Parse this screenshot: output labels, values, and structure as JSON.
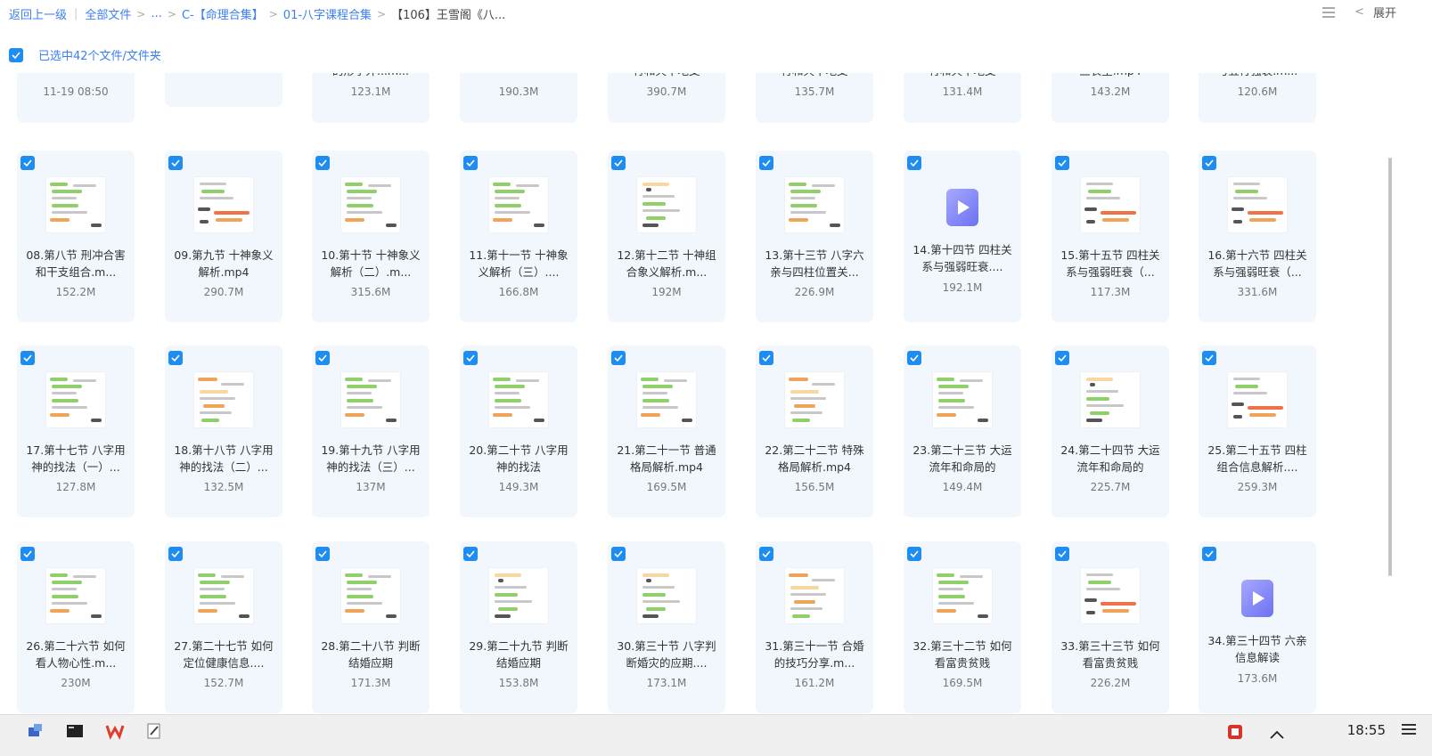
{
  "breadcrumb": {
    "back": "返回上一级",
    "all_files": "全部文件",
    "ellipsis": "...",
    "c_folder": "C-【命理合集】",
    "course": "01-八字课程合集",
    "current": "【106】王雪阁《八..."
  },
  "toolbar": {
    "expand": "展开"
  },
  "selection": {
    "label": "已选中42个文件/文件夹"
  },
  "top_partial": [
    {
      "name": "",
      "size": "11-19 08:50"
    },
    {
      "name": "",
      "size": ""
    },
    {
      "name": "的形学外...m...",
      "size": "123.1M"
    },
    {
      "name": "",
      "size": "190.3M"
    },
    {
      "name": "行和天干地支",
      "size": "390.7M"
    },
    {
      "name": "行和天干地支",
      "size": "135.7M"
    },
    {
      "name": "行和天干地支",
      "size": "131.4M"
    },
    {
      "name": "三长生.mp4",
      "size": "143.2M"
    },
    {
      "name": "与五行强衰.m...",
      "size": "120.6M"
    }
  ],
  "rows": [
    [
      {
        "name": "08.第八节 刑冲合害和干支组合.m...",
        "size": "152.2M",
        "thumb": "a"
      },
      {
        "name": "09.第九节 十神象义解析.mp4",
        "size": "290.7M",
        "thumb": "c"
      },
      {
        "name": "10.第十节 十神象义解析（二）.m...",
        "size": "315.6M",
        "thumb": "a"
      },
      {
        "name": "11.第十一节 十神象义解析（三）....",
        "size": "166.8M",
        "thumb": "a"
      },
      {
        "name": "12.第十二节 十神组合象义解析.m...",
        "size": "192M",
        "thumb": "b"
      },
      {
        "name": "13.第十三节 八字六亲与四柱位置关...",
        "size": "226.9M",
        "thumb": "a"
      },
      {
        "name": "14.第十四节 四柱关系与强弱旺衰....",
        "size": "192.1M",
        "thumb": "video"
      },
      {
        "name": "15.第十五节 四柱关系与强弱旺衰（...",
        "size": "117.3M",
        "thumb": "c"
      },
      {
        "name": "16.第十六节 四柱关系与强弱旺衰（...",
        "size": "331.6M",
        "thumb": "c"
      }
    ],
    [
      {
        "name": "17.第十七节 八字用神的找法（一）...",
        "size": "127.8M",
        "thumb": "a"
      },
      {
        "name": "18.第十八节 八字用神的找法（二）...",
        "size": "132.5M",
        "thumb": "d"
      },
      {
        "name": "19.第十九节 八字用神的找法（三）...",
        "size": "137M",
        "thumb": "a"
      },
      {
        "name": "20.第二十节 八字用神的找法",
        "size": "149.3M",
        "thumb": "a"
      },
      {
        "name": "21.第二十一节 普通格局解析.mp4",
        "size": "169.5M",
        "thumb": "a"
      },
      {
        "name": "22.第二十二节 特殊格局解析.mp4",
        "size": "156.5M",
        "thumb": "d"
      },
      {
        "name": "23.第二十三节 大运流年和命局的",
        "size": "149.4M",
        "thumb": "a"
      },
      {
        "name": "24.第二十四节 大运流年和命局的",
        "size": "225.7M",
        "thumb": "b"
      },
      {
        "name": "25.第二十五节 四柱组合信息解析....",
        "size": "259.3M",
        "thumb": "c"
      }
    ],
    [
      {
        "name": "26.第二十六节 如何看人物心性.m...",
        "size": "230M",
        "thumb": "a"
      },
      {
        "name": "27.第二十七节 如何定位健康信息....",
        "size": "152.7M",
        "thumb": "a"
      },
      {
        "name": "28.第二十八节 判断结婚应期",
        "size": "171.3M",
        "thumb": "a"
      },
      {
        "name": "29.第二十九节 判断结婚应期",
        "size": "153.8M",
        "thumb": "b"
      },
      {
        "name": "30.第三十节 八字判断婚灾的应期....",
        "size": "173.1M",
        "thumb": "b"
      },
      {
        "name": "31.第三十一节 合婚的技巧分享.m...",
        "size": "161.2M",
        "thumb": "d"
      },
      {
        "name": "32.第三十二节 如何看富贵贫贱",
        "size": "169.5M",
        "thumb": "a"
      },
      {
        "name": "33.第三十三节 如何看富贵贫贱",
        "size": "226.2M",
        "thumb": "c"
      },
      {
        "name": "34.第三十四节 六亲信息解读",
        "size": "173.6M",
        "thumb": "video"
      }
    ]
  ],
  "taskbar": {
    "time": "18:55"
  },
  "colors": {
    "accent": "#3b7ff0",
    "checkbox": "#1e8cf0",
    "card_bg": "#f1f7fd"
  }
}
